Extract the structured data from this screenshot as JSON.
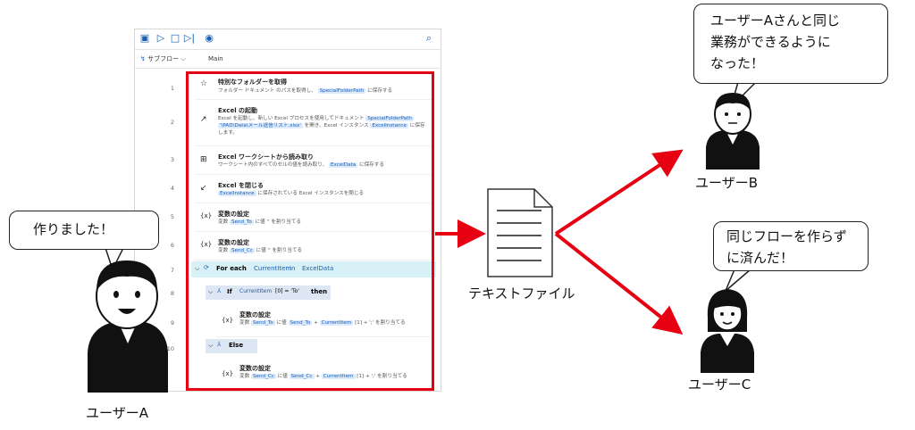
{
  "toolbar": {
    "icons": [
      "save-icon",
      "play-icon",
      "stop-icon",
      "next-step-icon",
      "record-icon",
      "search-icon"
    ]
  },
  "subbar": {
    "subflow_label": "サブフロー",
    "main_tab": "Main"
  },
  "line_numbers": [
    "1",
    "2",
    "3",
    "4",
    "5",
    "6",
    "7",
    "8",
    "9",
    "10"
  ],
  "steps": [
    {
      "title": "特別なフォルダーを取得",
      "desc_pre": "フォルダー ドキュメント のパスを取得し、",
      "token": "SpecialFolderPath",
      "desc_post": "に保存する"
    },
    {
      "title": "Excel の起動",
      "desc_a": "Excel を起動し、新しい Excel プロセスを使用してドキュメント",
      "token_a": "SpecialFolderPath",
      "token_b": "'\\PAD\\Data\\メール送信リスト.xlsx'",
      "desc_b": "を開き、Excel インスタンス",
      "token_c": "ExcelInstance",
      "desc_c": "に保存します。"
    },
    {
      "title": "Excel ワークシートから読み取り",
      "desc_pre": "ワークシート内のすべてのセルの値を読み取り、",
      "token": "ExcelData",
      "desc_post": "に保存する"
    },
    {
      "title": "Excel を閉じる",
      "token": "ExcelInstance",
      "desc_post": "に保存されている Excel インスタンスを閉じる"
    },
    {
      "title": "変数の設定",
      "desc_pre": "変数",
      "token": "Send_To",
      "desc_post": "に値 '' を割り当てる"
    },
    {
      "title": "変数の設定",
      "desc_pre": "変数",
      "token": "Send_Cc",
      "desc_post": "に値 '' を割り当てる"
    }
  ],
  "foreach": {
    "keyword": "For each",
    "var": "CurrentItem",
    "in": "in",
    "collection": "ExcelData"
  },
  "if_block": {
    "keyword": "If",
    "cond": "CurrentItem",
    "cond_rest": "[0] = 'To'",
    "then": "then"
  },
  "if_step": {
    "title": "変数の設定",
    "pre": "変数",
    "tok1": "Send_To",
    "mid": "に値",
    "tok2": "Send_To",
    "plus": "+",
    "tok3": "CurrentItem",
    "rest": "[1] + ';' を割り当てる"
  },
  "else_block": {
    "keyword": "Else"
  },
  "else_step": {
    "title": "変数の設定",
    "pre": "変数",
    "tok1": "Send_Cc",
    "mid": "に値",
    "tok2": "Send_Cc",
    "plus": "+",
    "tok3": "CurrentItem",
    "rest": "[1] + ';' を割り当てる"
  },
  "bubble_a": "作りました！",
  "bubble_b": [
    "ユーザーAさんと同じ",
    "業務ができるように",
    "なった！"
  ],
  "bubble_c": [
    "同じフローを作らず",
    "に済んだ！"
  ],
  "user_a": "ユーザーA",
  "user_b": "ユーザーB",
  "user_c": "ユーザーC",
  "file_label": "テキストファイル",
  "colors": {
    "accent_red": "#e60012",
    "token_blue": "#1a5fb4",
    "foreach_bg": "#d7f1f6"
  }
}
